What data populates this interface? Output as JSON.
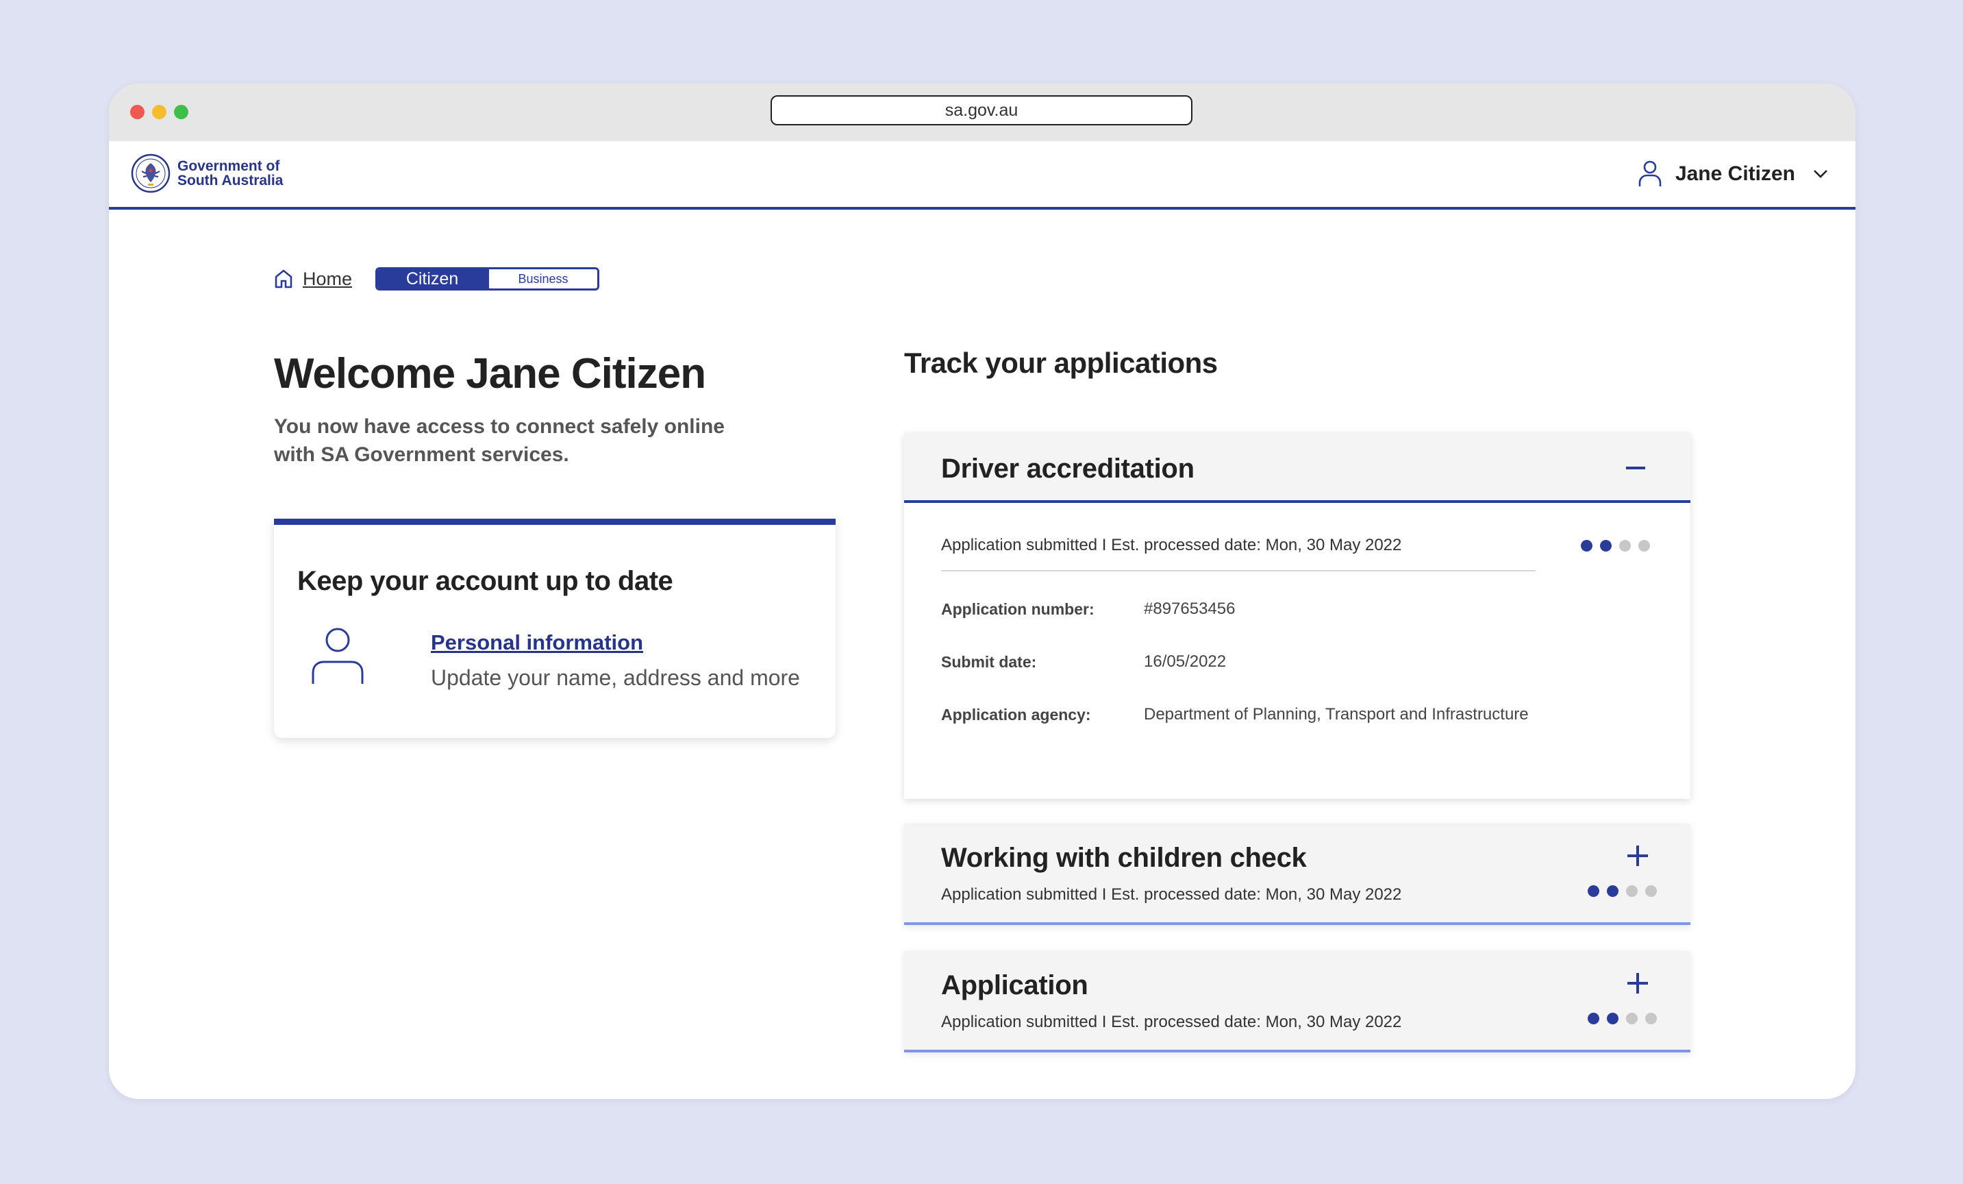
{
  "browser": {
    "url": "sa.gov.au"
  },
  "header": {
    "logo_line1": "Government of",
    "logo_line2": "South Australia",
    "user_name": "Jane Citizen"
  },
  "breadcrumb": {
    "home_label": "Home",
    "toggle_active": "Citizen",
    "toggle_inactive": "Business"
  },
  "welcome": {
    "title": "Welcome Jane Citizen",
    "subtitle": "You now have access to connect safely online with SA Government services."
  },
  "account_card": {
    "title": "Keep your account up to date",
    "link_label": "Personal information",
    "link_description": "Update your name, address and more"
  },
  "track": {
    "title": "Track your applications",
    "applications": [
      {
        "title": "Driver accreditation",
        "status": "Application submitted  I  Est. processed date: Mon, 30 May 2022",
        "expanded": true,
        "progress_steps_done": 2,
        "progress_steps_total": 4,
        "fields": [
          {
            "label": "Application number:",
            "value": "#897653456"
          },
          {
            "label": "Submit date:",
            "value": "16/05/2022"
          },
          {
            "label": "Application agency:",
            "value": "Department of Planning, Transport and Infrastructure"
          }
        ]
      },
      {
        "title": "Working with children check",
        "status": "Application submitted  I  Est. processed date: Mon, 30 May 2022",
        "expanded": false,
        "progress_steps_done": 2,
        "progress_steps_total": 4
      },
      {
        "title": "Application",
        "status": "Application submitted  I  Est. processed date: Mon, 30 May 2022",
        "expanded": false,
        "progress_steps_done": 2,
        "progress_steps_total": 4
      }
    ]
  },
  "colors": {
    "brand_blue": "#2a3c9b",
    "accent_light_blue": "#7f95e8",
    "page_background": "#dfe2f2"
  },
  "icons": [
    "home-icon",
    "user-icon",
    "chevron-down-icon",
    "minus-icon",
    "plus-icon",
    "sa-crest-logo"
  ]
}
